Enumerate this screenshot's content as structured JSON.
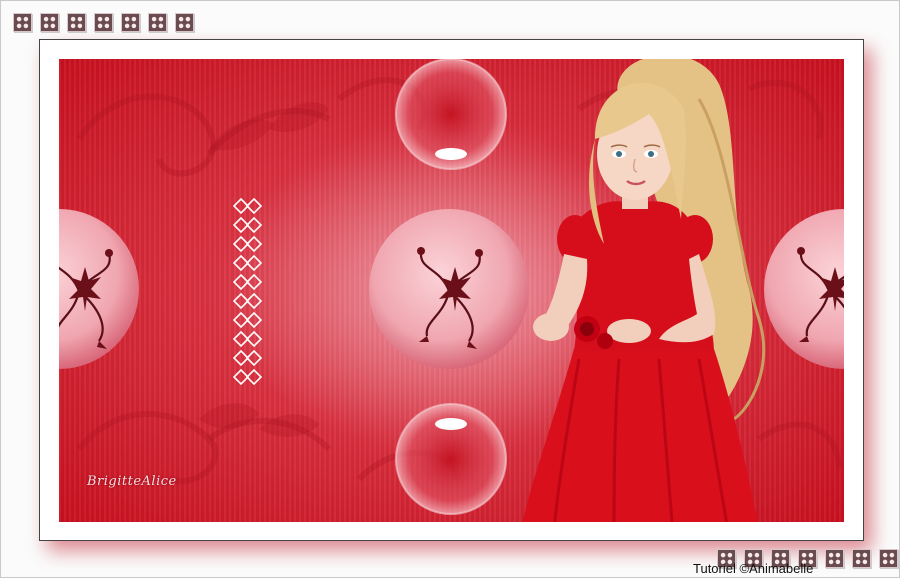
{
  "decor": {
    "top_ornaments": 7,
    "bottom_ornaments": 7,
    "colors": {
      "background": "#fbfbfb",
      "frame": "#ffffff",
      "art_red": "#d4202f",
      "shadow_red": "#b90014",
      "dress": "#d90f1c",
      "hair": "#e7c88c"
    },
    "icons": [
      "ornament-tile-icon",
      "floral-medallion-icon",
      "glass-bubble-icon",
      "ornament-column-icon"
    ]
  },
  "artwork": {
    "signature": "BrigitteAlice"
  },
  "footer": {
    "credit": "Tutoriel ©Animabelle"
  }
}
